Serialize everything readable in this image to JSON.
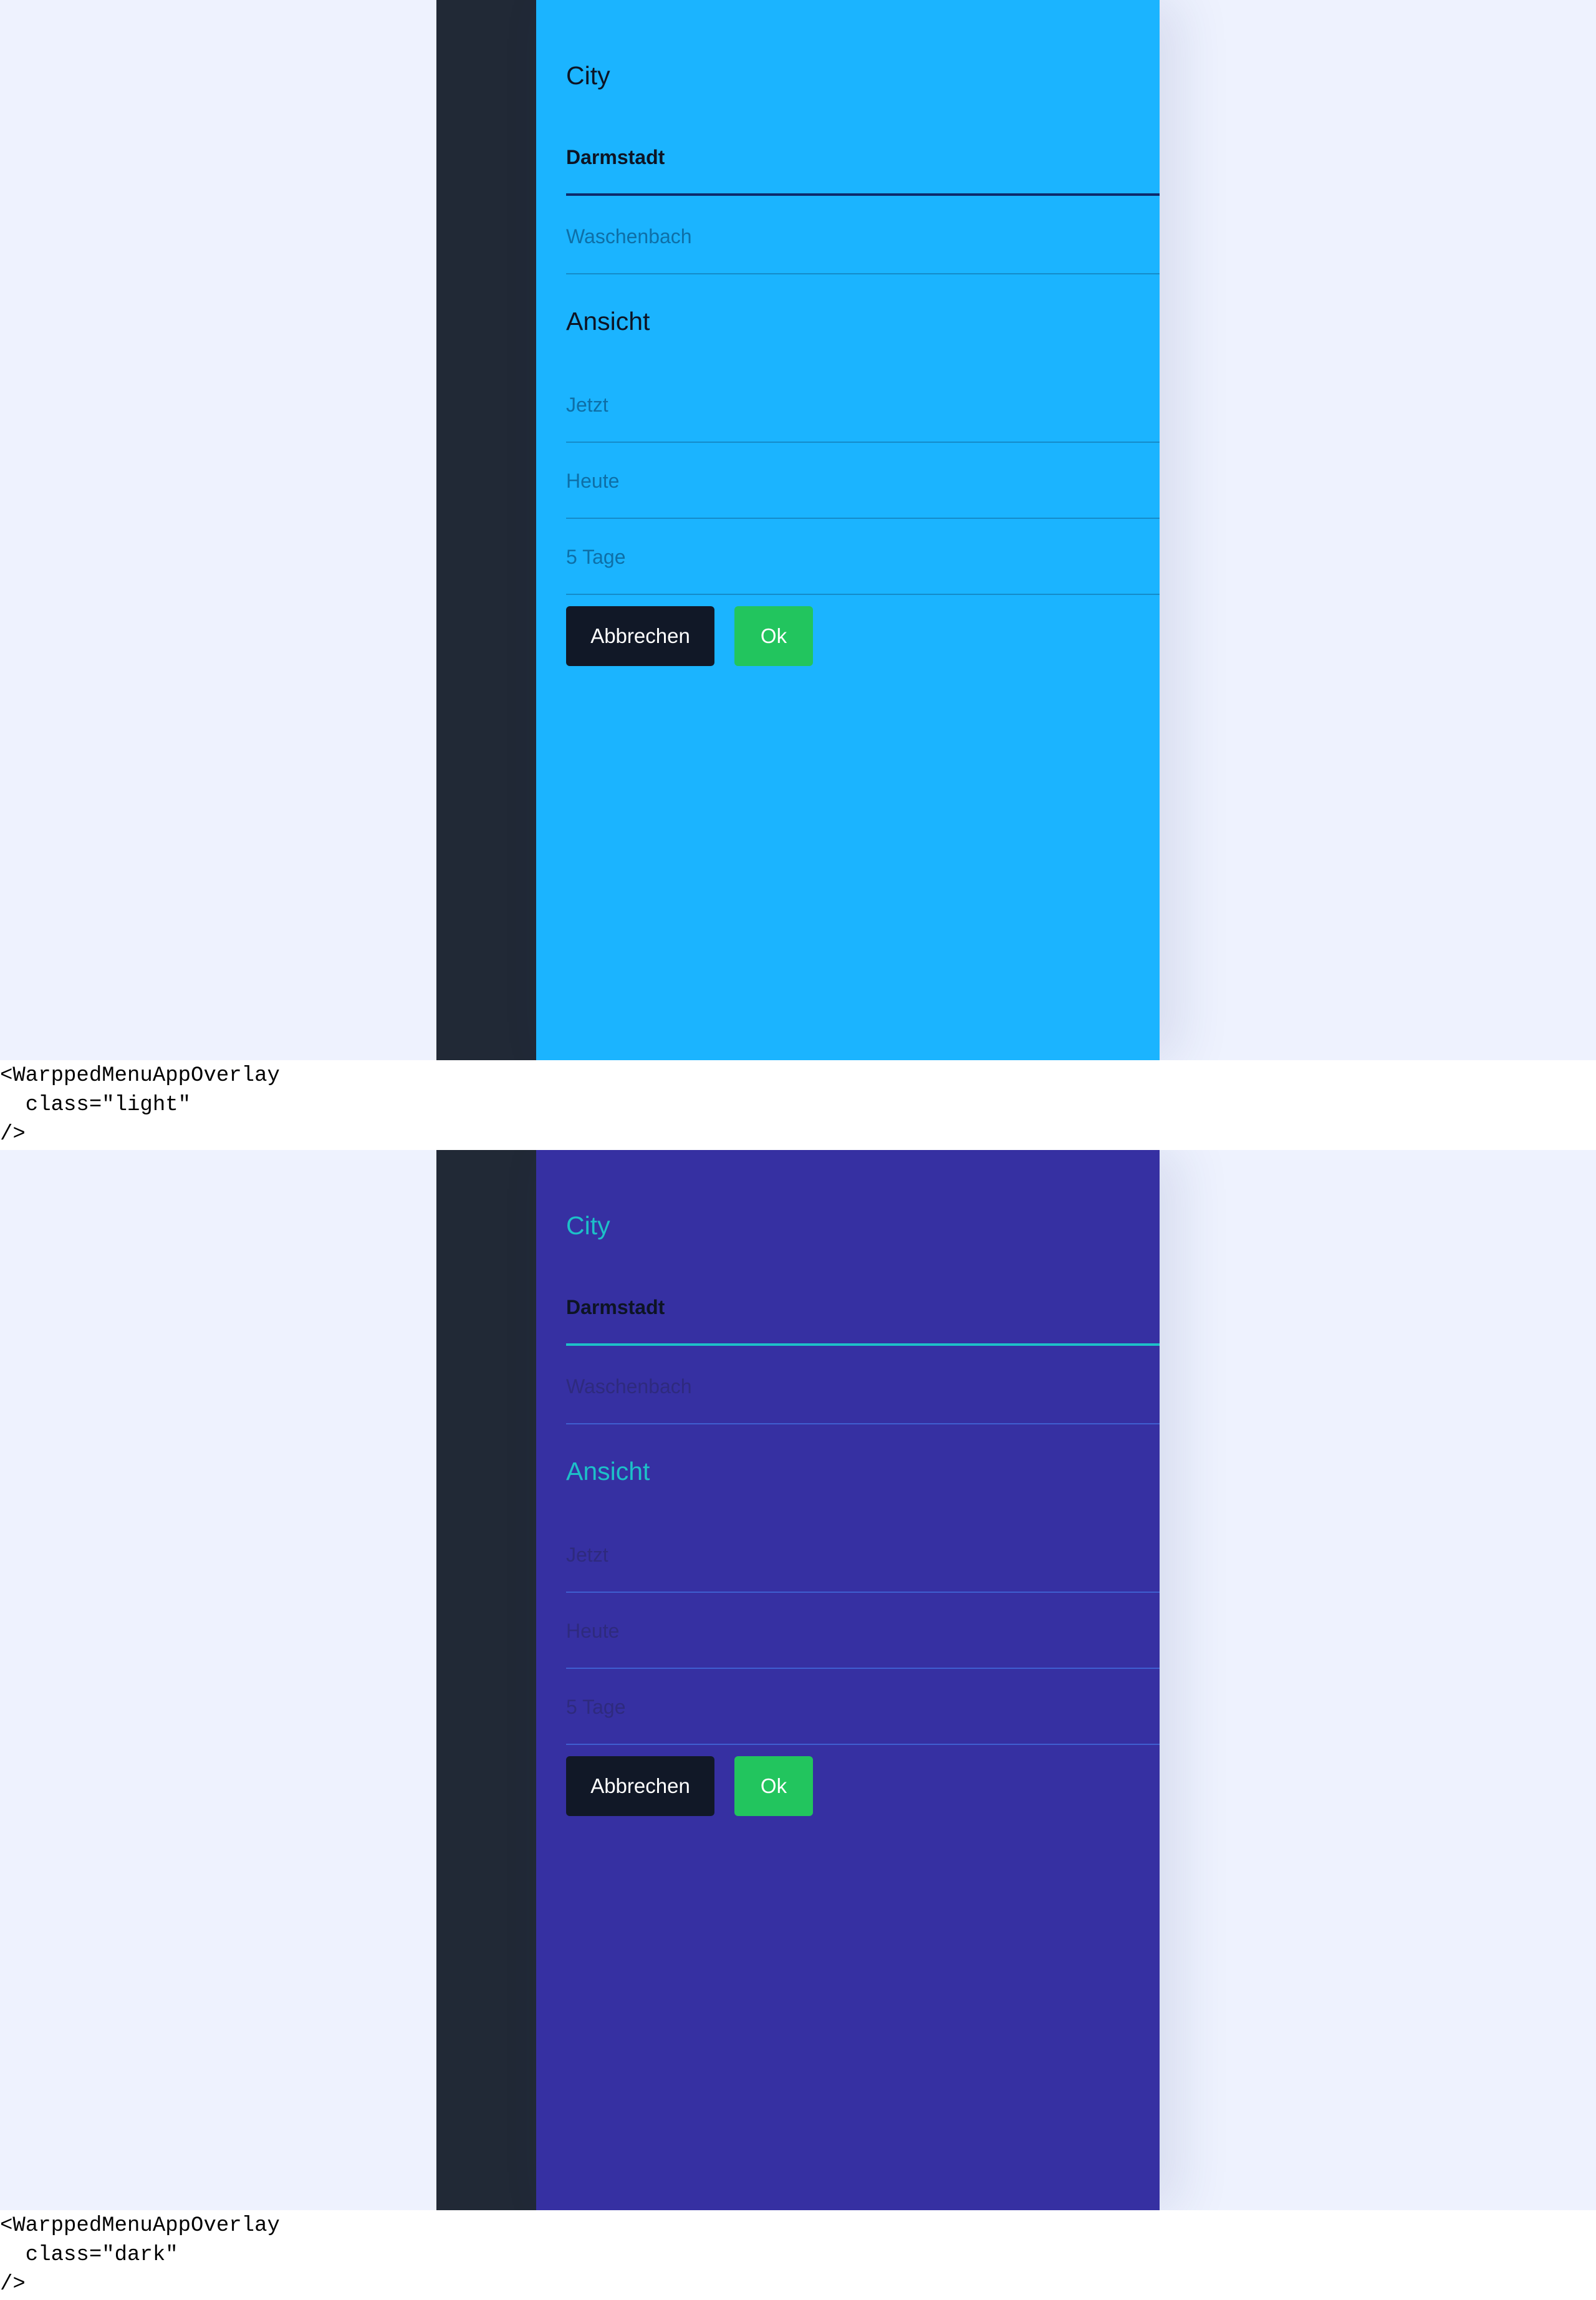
{
  "colors": {
    "page_bg": "#eef2fe",
    "rail": "#212936",
    "light_panel": "#1bb4ff",
    "dark_panel": "#3630a2",
    "dark_accent": "#1dc0c8",
    "cancel_button": "#111827",
    "ok_button": "#22c55e"
  },
  "light": {
    "city_title": "City",
    "city_options": [
      "Darmstadt",
      "Waschenbach"
    ],
    "view_title": "Ansicht",
    "view_options": [
      "Jetzt",
      "Heute",
      "5 Tage"
    ],
    "cancel_label": "Abbrechen",
    "ok_label": "Ok",
    "code_lines": [
      "<WarppedMenuAppOverlay",
      "  class=\"light\"",
      "/>"
    ]
  },
  "dark": {
    "city_title": "City",
    "city_options": [
      "Darmstadt",
      "Waschenbach"
    ],
    "view_title": "Ansicht",
    "view_options": [
      "Jetzt",
      "Heute",
      "5 Tage"
    ],
    "cancel_label": "Abbrechen",
    "ok_label": "Ok",
    "code_lines": [
      "<WarppedMenuAppOverlay",
      "  class=\"dark\"",
      "/>"
    ]
  }
}
